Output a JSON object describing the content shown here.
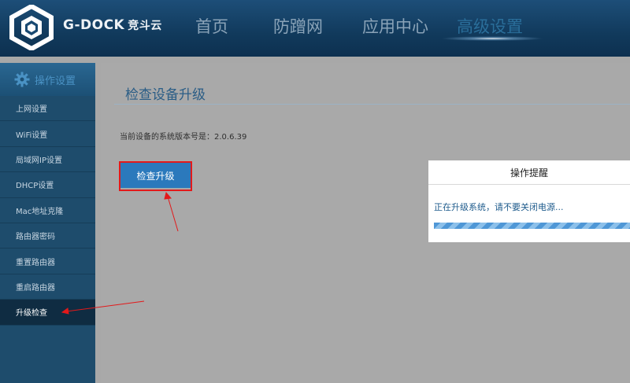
{
  "header": {
    "brand_en": "G-DOCK",
    "brand_cn": "竞斗云",
    "nav": [
      "首页",
      "防蹭网",
      "应用中心",
      "高级设置"
    ],
    "active_nav_index": 3
  },
  "sidebar": {
    "heading": "操作设置",
    "items": [
      "上网设置",
      "WiFi设置",
      "局域网IP设置",
      "DHCP设置",
      "Mac地址克隆",
      "路由器密码",
      "重置路由器",
      "重启路由器",
      "升级检查"
    ],
    "active_index": 8
  },
  "main": {
    "title": "检查设备升级",
    "version_label": "当前设备的系统版本号是：2.0.6.39",
    "check_button": "检查升级"
  },
  "dialog": {
    "title": "操作提醒",
    "message": "正在升级系统，请不要关闭电源...",
    "progress": 1.0
  },
  "colors": {
    "header_bg": "#113a5c",
    "sidebar_bg": "#1e4c6c",
    "button_bg": "#2b79bc",
    "annotation_red": "#e3191a"
  }
}
